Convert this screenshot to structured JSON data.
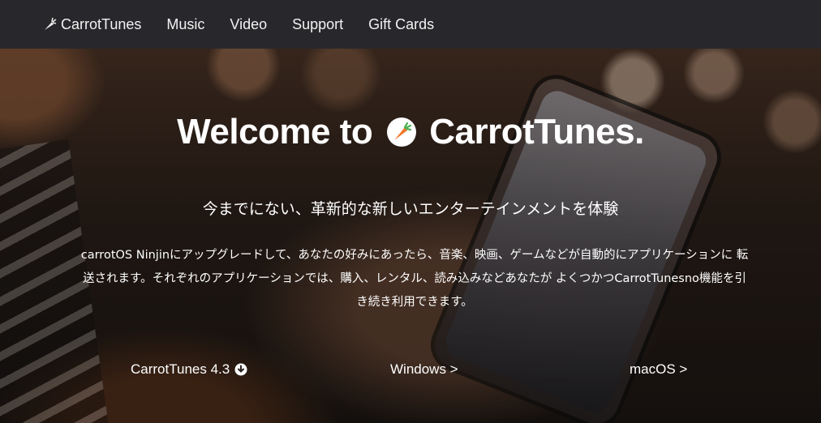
{
  "nav": {
    "brand": "CarrotTunes",
    "items": [
      {
        "label": "Music"
      },
      {
        "label": "Video"
      },
      {
        "label": "Support"
      },
      {
        "label": "Gift Cards"
      }
    ]
  },
  "hero": {
    "headline_before": "Welcome to",
    "headline_after": "CarrotTunes.",
    "subheading": "今までにない、革新的な新しいエンターテインメントを体験",
    "body": "carrotOS Ninjinにアップグレードして、あなたの好みにあったら、音楽、映画、ゲームなどが自動的にアプリケーションに 転送されます。それぞれのアプリケーションでは、購入、レンタル、読み込みなどあなたが よくつかつCarrotTunesno機能を引き続き利用できます。"
  },
  "downloads": {
    "carrottunes": "CarrotTunes 4.3",
    "windows": "Windows >",
    "macos": "macOS >"
  },
  "icons": {
    "brand": "carrot-icon",
    "headline": "carrot-badge-icon",
    "download": "download-circle-icon"
  },
  "colors": {
    "navbar": "#28282c",
    "carrot": "#f0782c",
    "carrot_leaf": "#4caf50"
  }
}
